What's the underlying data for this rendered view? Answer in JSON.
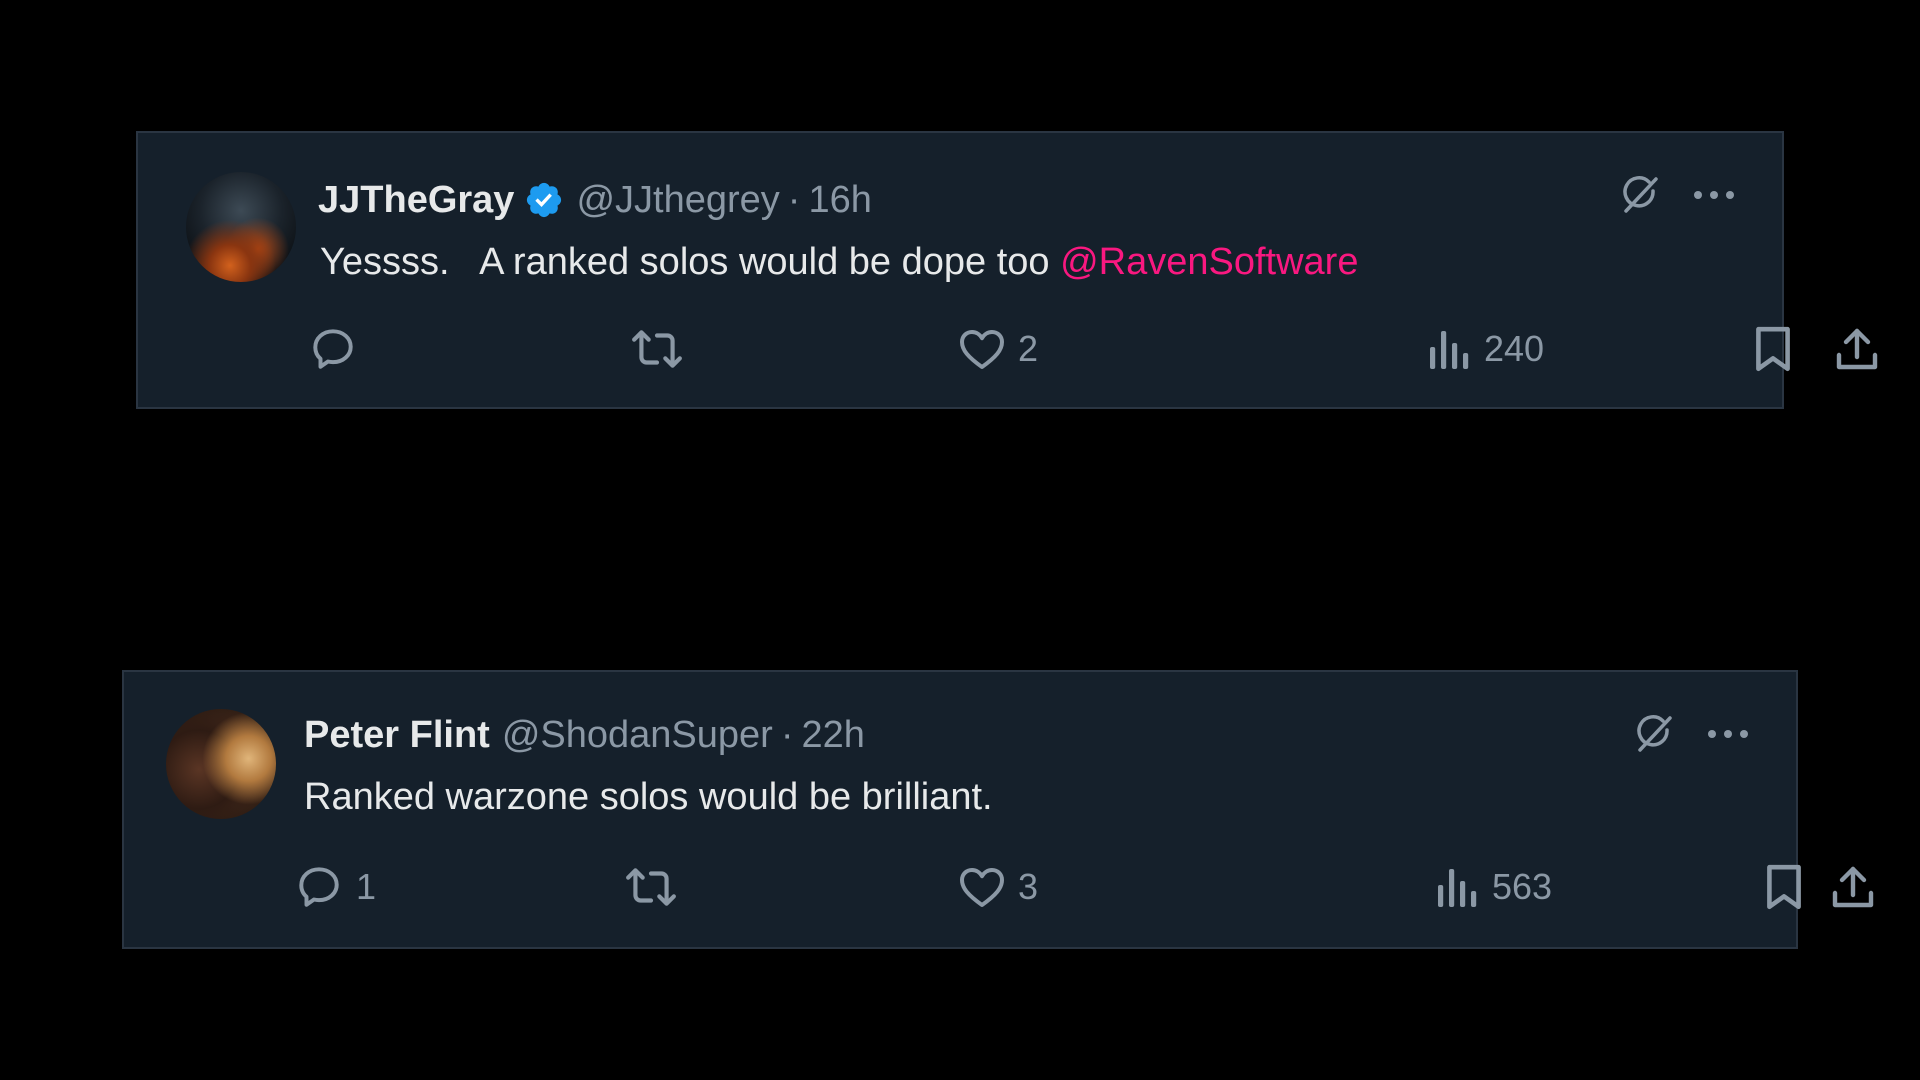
{
  "tweets": [
    {
      "display_name": "JJTheGray",
      "verified": true,
      "handle": "@JJthegrey",
      "separator": "·",
      "time": "16h",
      "text_before": "Yessss.   A ranked solos would be dope too ",
      "mention": "@RavenSoftware",
      "reply_count": "",
      "retweet_count": "",
      "like_count": "2",
      "view_count": "240"
    },
    {
      "display_name": "Peter Flint",
      "verified": false,
      "handle": "@ShodanSuper",
      "separator": "·",
      "time": "22h",
      "text_before": "Ranked warzone solos would be brilliant.",
      "mention": "",
      "reply_count": "1",
      "retweet_count": "",
      "like_count": "3",
      "view_count": "563"
    }
  ],
  "colors": {
    "background": "#000000",
    "card": "#15202b",
    "text": "#e7e9ea",
    "muted": "#8b98a5",
    "mention": "#f91880",
    "verified": "#1d9bf0"
  },
  "icons": [
    "verified-badge-icon",
    "grok-icon",
    "more-icon",
    "reply-icon",
    "retweet-icon",
    "like-icon",
    "views-icon",
    "bookmark-icon",
    "share-icon"
  ]
}
